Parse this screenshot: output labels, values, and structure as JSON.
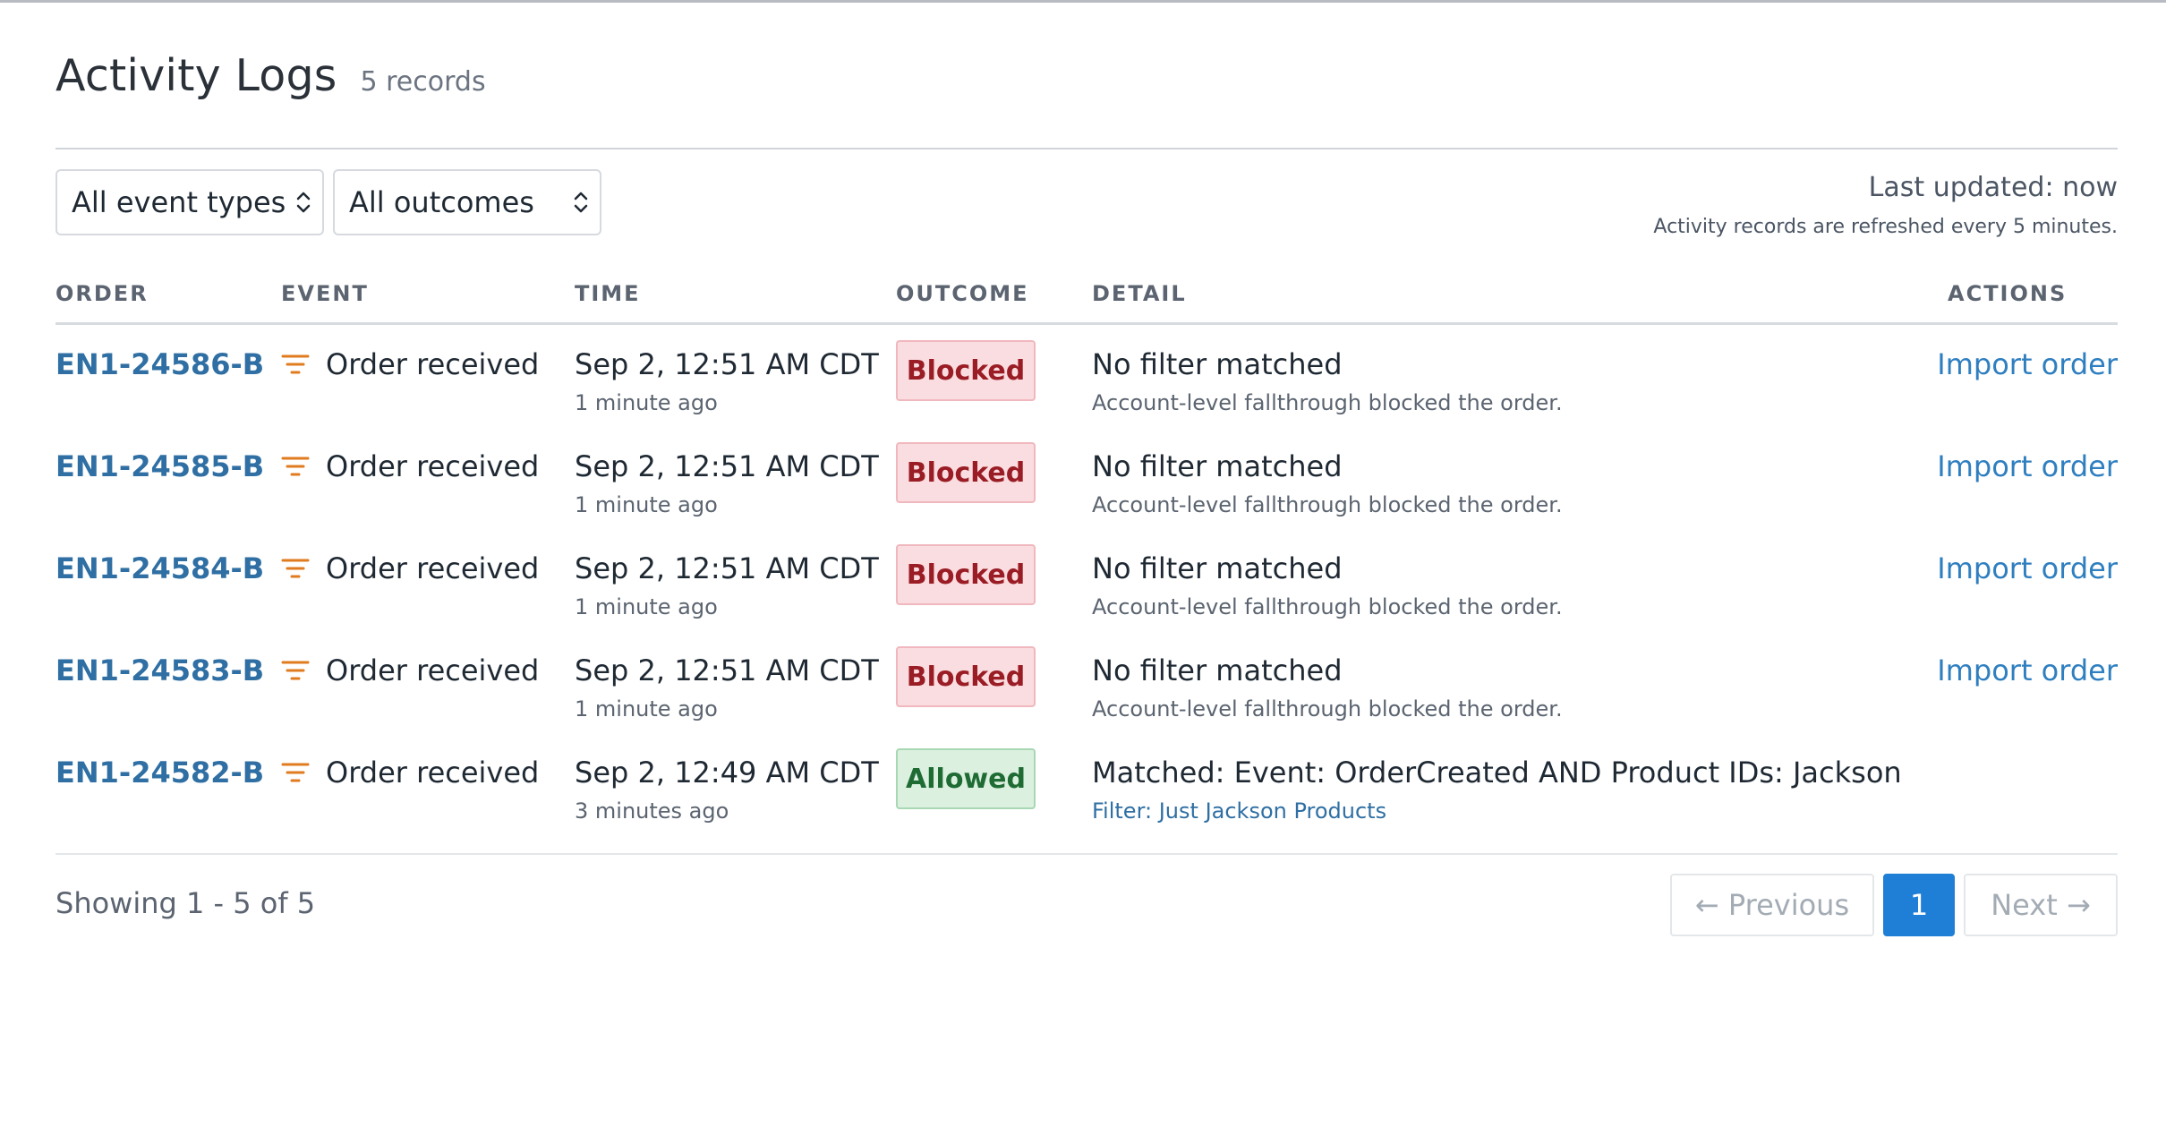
{
  "header": {
    "title": "Activity Logs",
    "count": "5 records"
  },
  "filters": {
    "event_types": "All event types",
    "outcomes": "All outcomes"
  },
  "status": {
    "last_updated": "Last updated: now",
    "refresh_note": "Activity records are refreshed every 5 minutes."
  },
  "table": {
    "columns": [
      "ORDER",
      "EVENT",
      "TIME",
      "OUTCOME",
      "DETAIL",
      "ACTIONS"
    ],
    "rows": [
      {
        "order": "EN1-24586-B",
        "event": "Order received",
        "time": "Sep 2, 12:51 AM CDT",
        "ago": "1 minute ago",
        "outcome": "Blocked",
        "detail": "No filter matched",
        "detail_sub": "Account-level fallthrough blocked the order.",
        "action": "Import order"
      },
      {
        "order": "EN1-24585-B",
        "event": "Order received",
        "time": "Sep 2, 12:51 AM CDT",
        "ago": "1 minute ago",
        "outcome": "Blocked",
        "detail": "No filter matched",
        "detail_sub": "Account-level fallthrough blocked the order.",
        "action": "Import order"
      },
      {
        "order": "EN1-24584-B",
        "event": "Order received",
        "time": "Sep 2, 12:51 AM CDT",
        "ago": "1 minute ago",
        "outcome": "Blocked",
        "detail": "No filter matched",
        "detail_sub": "Account-level fallthrough blocked the order.",
        "action": "Import order"
      },
      {
        "order": "EN1-24583-B",
        "event": "Order received",
        "time": "Sep 2, 12:51 AM CDT",
        "ago": "1 minute ago",
        "outcome": "Blocked",
        "detail": "No filter matched",
        "detail_sub": "Account-level fallthrough blocked the order.",
        "action": "Import order"
      },
      {
        "order": "EN1-24582-B",
        "event": "Order received",
        "time": "Sep 2, 12:49 AM CDT",
        "ago": "3 minutes ago",
        "outcome": "Allowed",
        "detail": "Matched: Event: OrderCreated AND Product IDs: Jackson",
        "detail_sub": "Filter: Just Jackson Products",
        "action": ""
      }
    ]
  },
  "footer": {
    "showing": "Showing 1 - 5 of 5",
    "prev": "← Previous",
    "page": "1",
    "next": "Next →"
  },
  "colors": {
    "link": "#2f6fa3",
    "accent": "#1f7fd6",
    "blocked": "#9a1c24",
    "allowed": "#1e6b34",
    "event_icon": "#e07b1f"
  },
  "icons": {
    "event": "filter-icon",
    "select": "chevron-updown-icon"
  }
}
